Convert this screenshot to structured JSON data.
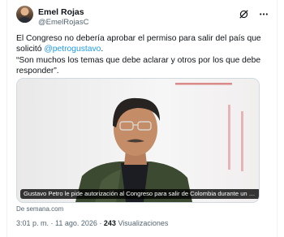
{
  "author": {
    "name": "Emel Rojas",
    "handle": "@EmelRojasC"
  },
  "icons": {
    "grok": "grok-icon",
    "more": "more-options-icon"
  },
  "tweet": {
    "line1": "El Congreso no debería aprobar el permiso para salir del país que solicitó ",
    "mention": "@petrogustavo",
    "mention_suffix": ".",
    "quote": "“Son muchos los temas que debe aclarar y otros por los que debe responder”."
  },
  "card": {
    "caption": "Gustavo Petro le pide autorización al Congreso para salir de Colombia durante un año; ...",
    "source": "De semana.com"
  },
  "meta": {
    "time": "3:01 p. m.",
    "separator": " · ",
    "date": "11 ago. 2026",
    "views_count": "243",
    "views_label": "Visualizaciones"
  },
  "colors": {
    "link": "#1d9bf0",
    "text": "#0f1419",
    "secondary": "#536471",
    "border": "#cfd9de"
  }
}
